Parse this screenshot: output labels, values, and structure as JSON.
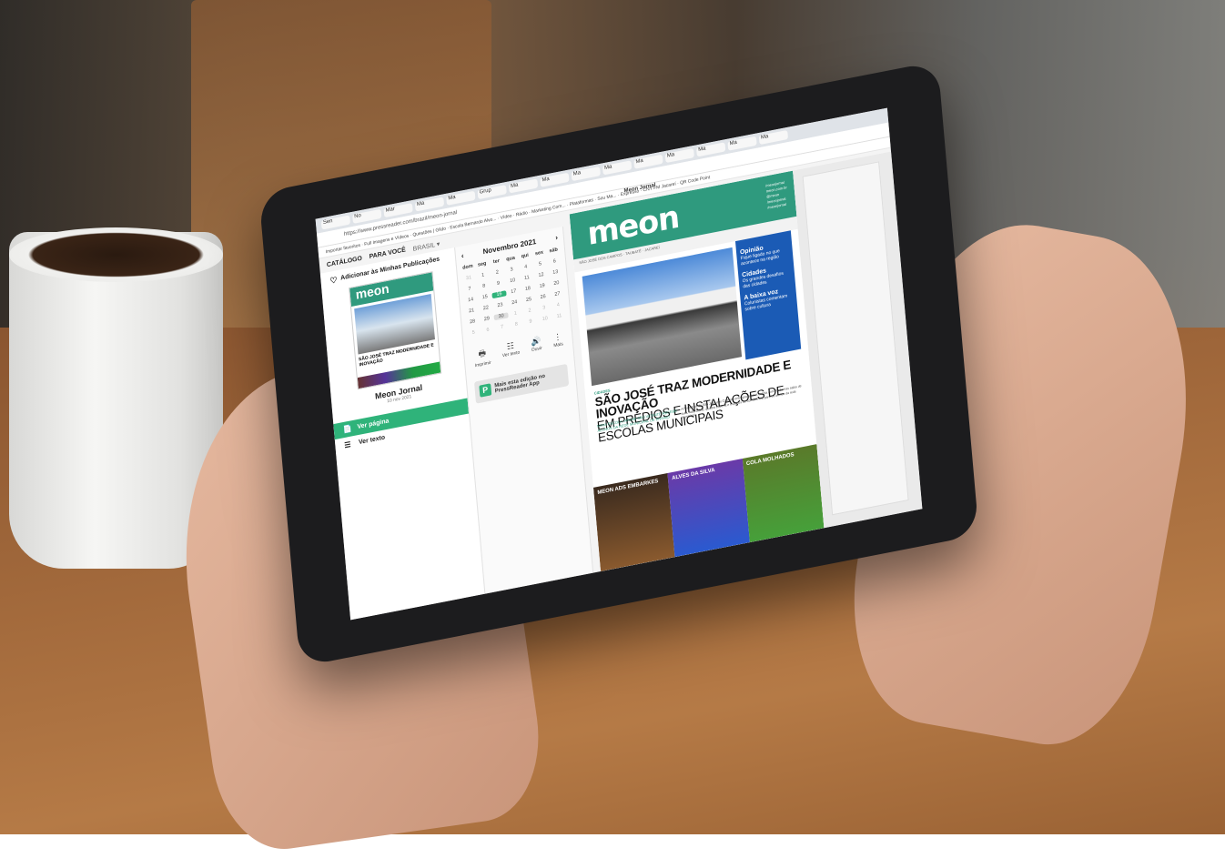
{
  "browser": {
    "tabs": [
      "Sen",
      "No",
      "Mar",
      "Ma",
      "Ma",
      "Grup",
      "Ma",
      "Ma",
      "Ma",
      "Ma",
      "Ma",
      "Ma",
      "Ma",
      "Ma",
      "Ma"
    ],
    "url": "https://www.pressreader.com/brazil/meon-jornal",
    "bookmarks": "Importar favoritos  ·  Full Imagens e Vídeos  ·  Questões | Gildo  ·  Escola Bernardo Alvo...  ·  Vídeo  ·  Rádio  ·  Marketing Com...  ·  Plataformas  ·  Sou Ma...  ·  Expresso  ·  CNY FM Jacareí  ·  QR Code Point",
    "page_title": "Meon Jornal"
  },
  "nav": {
    "catalog": "CATÁLOGO",
    "for_you": "PARA VOCÊ",
    "region": "BRASIL ▾"
  },
  "sidebar": {
    "favorite_label": "Adicionar às Minhas Publicações",
    "thumb_logo": "meon",
    "publication_name": "Meon Jornal",
    "publication_date": "10 nov 2021",
    "menu": [
      {
        "label": "Ver página",
        "icon": "📄"
      },
      {
        "label": "Ver texto",
        "icon": "☰"
      }
    ]
  },
  "calendar": {
    "month": "Novembro 2021",
    "prev": "‹",
    "next": "›",
    "weekdays": [
      "dom",
      "seg",
      "ter",
      "qua",
      "qui",
      "sex",
      "sáb"
    ],
    "days": [
      [
        "31",
        "1",
        "2",
        "3",
        "4",
        "5",
        "6"
      ],
      [
        "7",
        "8",
        "9",
        "10",
        "11",
        "12",
        "13"
      ],
      [
        "14",
        "15",
        "16",
        "17",
        "18",
        "19",
        "20"
      ],
      [
        "21",
        "22",
        "23",
        "24",
        "25",
        "26",
        "27"
      ],
      [
        "28",
        "29",
        "30",
        "1",
        "2",
        "3",
        "4"
      ],
      [
        "5",
        "6",
        "7",
        "8",
        "9",
        "10",
        "11"
      ]
    ],
    "selected_day": "16",
    "today": "30",
    "tools": [
      {
        "label": "Imprimir",
        "icon": "🖶"
      },
      {
        "label": "Ver texto",
        "icon": "☷"
      },
      {
        "label": "Ouvir",
        "icon": "🔊"
      },
      {
        "label": "Mais",
        "icon": "⋮"
      }
    ],
    "app_promo": "Mais esta edição no PressReader App"
  },
  "newspaper": {
    "logo": "meon",
    "links": [
      "/meonjornal",
      "meon.com.br",
      "@meon",
      "/meonjornal",
      "/meonjornal"
    ],
    "strip": "SÃO JOSÉ DOS CAMPOS  ·  TAUBATÉ  ·  JACAREÍ",
    "side": [
      {
        "title": "Opinião",
        "text": "Fique ligado no que acontece na região"
      },
      {
        "title": "Cidades",
        "text": "Os grandes desafios das cidades"
      },
      {
        "title": "A baixa voz",
        "text": "Colunistas comentam sobre cultura"
      }
    ],
    "kicker": "CIDADES",
    "headline_1": "SÃO JOSÉ TRAZ MODERNIDADE E INOVAÇÃO",
    "headline_2": "EM PRÉDIOS E INSTALAÇÕES DE ESCOLAS MUNICIPAIS",
    "deck": "NOVA ESCOLA JARDIM SÃO VICENTE RECEBE ALUNOS DA REDE MUNICIPAL DE ENSINO",
    "body": "A Prefeitura de São José dos Campos entregou a nova escola com modernas salas de aula, laboratório, quadra coberta e espaços de convivência para os alunos da rede municipal.",
    "promos": [
      "MEON ADS EMBARKES",
      "ALVES DA SILVA",
      "COLA MOLHADOS"
    ]
  }
}
